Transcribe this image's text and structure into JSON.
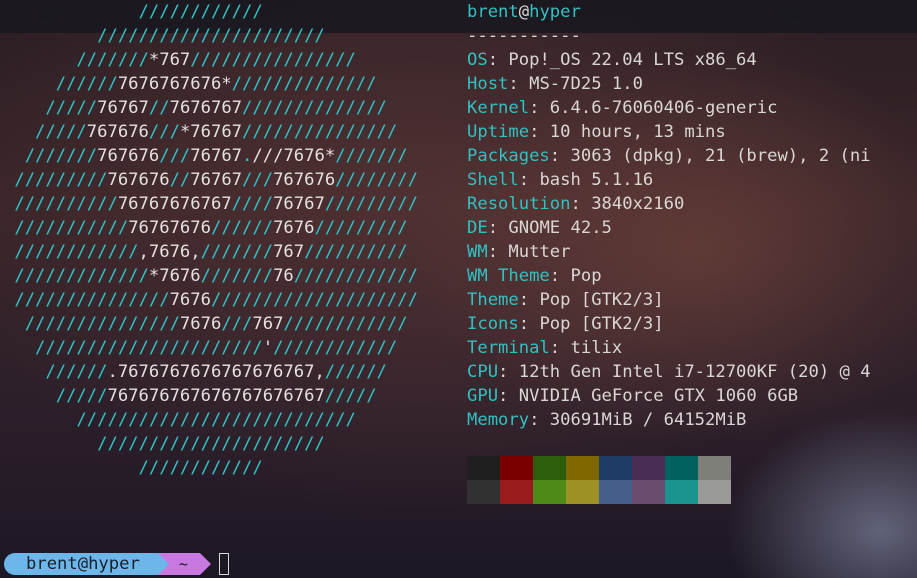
{
  "terminal": {
    "logo_lines": [
      [
        [
          "t",
          "             ////////////"
        ]
      ],
      [
        [
          "t",
          "         //////////////////////"
        ]
      ],
      [
        [
          "t",
          "       ///////"
        ],
        [
          "w",
          "*767"
        ],
        [
          "t",
          "////////////////"
        ]
      ],
      [
        [
          "t",
          "     //////"
        ],
        [
          "w",
          "7676767676*"
        ],
        [
          "t",
          "//////////////"
        ]
      ],
      [
        [
          "t",
          "    /////"
        ],
        [
          "w",
          "76767"
        ],
        [
          "t",
          "//"
        ],
        [
          "w",
          "7676767"
        ],
        [
          "t",
          "//////////////"
        ]
      ],
      [
        [
          "t",
          "   /////"
        ],
        [
          "w",
          "767676"
        ],
        [
          "t",
          "///"
        ],
        [
          "w",
          "*76767"
        ],
        [
          "t",
          "///////////////"
        ]
      ],
      [
        [
          "t",
          "  ///////"
        ],
        [
          "w",
          "767676"
        ],
        [
          "t",
          "///"
        ],
        [
          "w",
          "76767"
        ],
        [
          "t",
          "."
        ],
        [
          "w",
          "///"
        ],
        [
          "w",
          "7676*"
        ],
        [
          "t",
          "///////"
        ]
      ],
      [
        [
          "t",
          " /////////"
        ],
        [
          "w",
          "767676"
        ],
        [
          "t",
          "//"
        ],
        [
          "w",
          "76767"
        ],
        [
          "t",
          "///"
        ],
        [
          "w",
          "767676"
        ],
        [
          "t",
          "////////"
        ]
      ],
      [
        [
          "t",
          " //////////"
        ],
        [
          "w",
          "76767676767"
        ],
        [
          "t",
          "////"
        ],
        [
          "w",
          "76767"
        ],
        [
          "t",
          "/////////"
        ]
      ],
      [
        [
          "t",
          " ///////////"
        ],
        [
          "w",
          "76767676"
        ],
        [
          "t",
          "//////"
        ],
        [
          "w",
          "7676"
        ],
        [
          "t",
          "/////////"
        ]
      ],
      [
        [
          "t",
          " ////////////"
        ],
        [
          "w",
          ",7676,"
        ],
        [
          "t",
          "///////"
        ],
        [
          "w",
          "767"
        ],
        [
          "t",
          "//////////"
        ]
      ],
      [
        [
          "t",
          " /////////////"
        ],
        [
          "w",
          "*7676"
        ],
        [
          "t",
          "///////"
        ],
        [
          "w",
          "76"
        ],
        [
          "t",
          "////////////"
        ]
      ],
      [
        [
          "t",
          " ///////////////"
        ],
        [
          "w",
          "7676"
        ],
        [
          "t",
          "////////////////////"
        ]
      ],
      [
        [
          "t",
          "  ///////////////"
        ],
        [
          "w",
          "7676"
        ],
        [
          "t",
          "///"
        ],
        [
          "w",
          "767"
        ],
        [
          "t",
          "////////////"
        ]
      ],
      [
        [
          "t",
          "   //////////////////////"
        ],
        [
          "w",
          "'"
        ],
        [
          "t",
          "////////////"
        ]
      ],
      [
        [
          "t",
          "    //////"
        ],
        [
          "w",
          ".7676767676767676767,"
        ],
        [
          "t",
          "//////"
        ]
      ],
      [
        [
          "t",
          "     /////"
        ],
        [
          "w",
          "767676767676767676767"
        ],
        [
          "t",
          "/////"
        ]
      ],
      [
        [
          "t",
          "       ///////////////////////////"
        ]
      ],
      [
        [
          "t",
          "         //////////////////////"
        ]
      ],
      [
        [
          "t",
          "             ////////////"
        ]
      ]
    ],
    "user": "brent",
    "at": "@",
    "host": "hyper",
    "separator": "-----------",
    "info": [
      {
        "key": "OS",
        "value": "Pop!_OS 22.04 LTS x86_64"
      },
      {
        "key": "Host",
        "value": "MS-7D25 1.0"
      },
      {
        "key": "Kernel",
        "value": "6.4.6-76060406-generic"
      },
      {
        "key": "Uptime",
        "value": "10 hours, 13 mins"
      },
      {
        "key": "Packages",
        "value": "3063 (dpkg), 21 (brew), 2 (ni"
      },
      {
        "key": "Shell",
        "value": "bash 5.1.16"
      },
      {
        "key": "Resolution",
        "value": "3840x2160"
      },
      {
        "key": "DE",
        "value": "GNOME 42.5"
      },
      {
        "key": "WM",
        "value": "Mutter"
      },
      {
        "key": "WM Theme",
        "value": "Pop"
      },
      {
        "key": "Theme",
        "value": "Pop [GTK2/3]"
      },
      {
        "key": "Icons",
        "value": "Pop [GTK2/3]"
      },
      {
        "key": "Terminal",
        "value": "tilix"
      },
      {
        "key": "CPU",
        "value": "12th Gen Intel i7-12700KF (20) @ 4"
      },
      {
        "key": "GPU",
        "value": "NVIDIA GeForce GTX 1060 6GB"
      },
      {
        "key": "Memory",
        "value": "30691MiB / 64152MiB"
      }
    ],
    "key_separator": ": ",
    "palette": [
      "#1f1f1f",
      "#7a0000",
      "#2d5e0c",
      "#806800",
      "#1e3c66",
      "#4a2d55",
      "#00615e",
      "#7f7f7a",
      "#313131",
      "#9a1b1b",
      "#4e8a17",
      "#9d9125",
      "#44608a",
      "#6b4b6e",
      "#1a948f",
      "#9a9a98"
    ],
    "colors": {
      "accent_teal": "#31c1c3",
      "text": "#d9d7d4",
      "prompt_user_bg": "#6cb6ea",
      "prompt_dir_bg": "#c879e0"
    }
  },
  "prompt": {
    "user_host": "brent@hyper",
    "directory": "~"
  }
}
